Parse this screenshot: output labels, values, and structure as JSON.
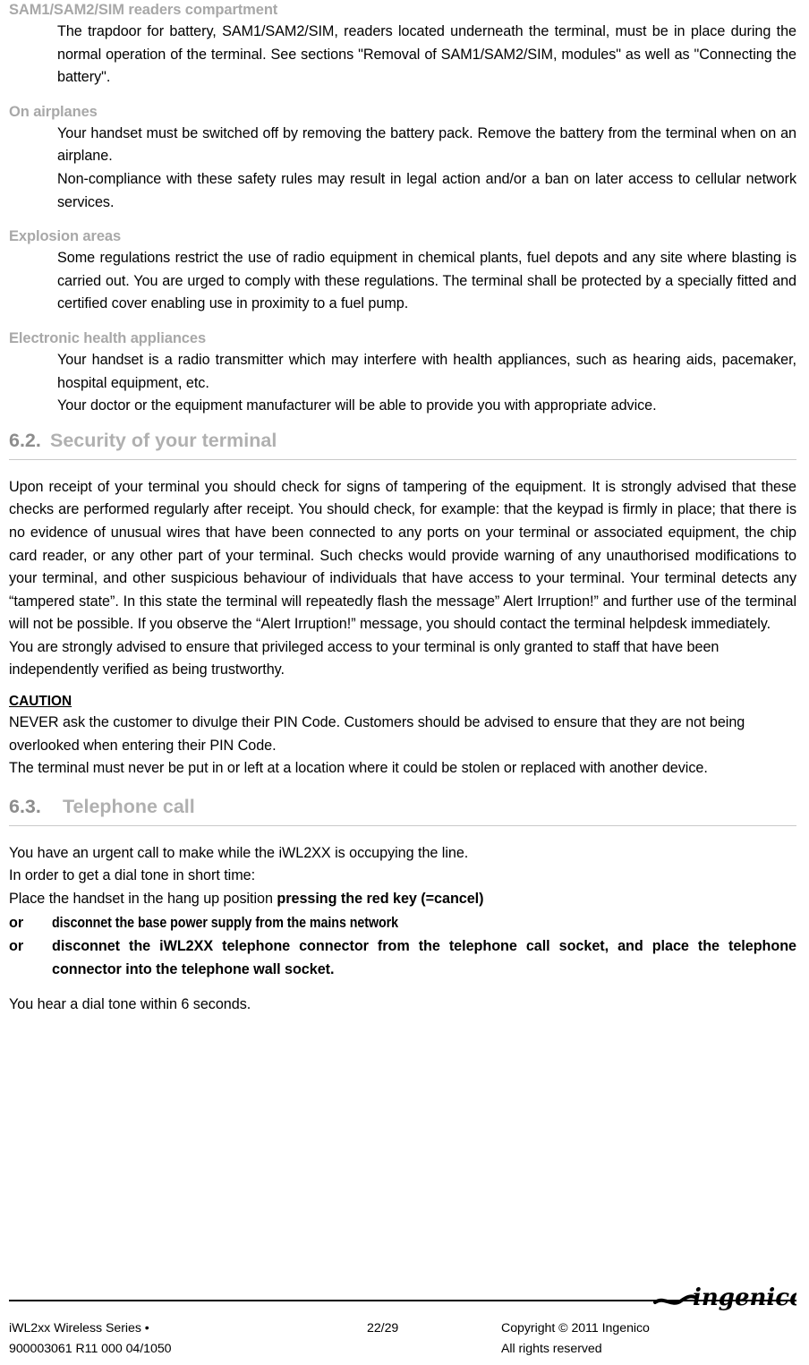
{
  "document": {
    "sections": [
      {
        "heading": "SAM1/SAM2/SIM readers compartment",
        "paragraphs": [
          "The trapdoor for battery, SAM1/SAM2/SIM, readers located underneath the terminal, must be in place during the normal operation of the terminal. See sections \"Removal of SAM1/SAM2/SIM, modules\" as well as \"Connecting the battery\"."
        ]
      },
      {
        "heading": "On airplanes",
        "paragraphs": [
          "Your handset must be switched off by removing the battery pack. Remove the battery from the terminal when on an airplane.",
          "Non-compliance with these safety rules may result in legal action and/or a ban on later access to cellular network services."
        ]
      },
      {
        "heading": "Explosion areas",
        "paragraphs": [
          "Some regulations restrict the use of radio equipment in chemical plants, fuel depots and any site where blasting is carried out. You are urged to comply with these regulations. The terminal shall be protected by a specially fitted and certified cover enabling use in proximity to a fuel pump."
        ]
      },
      {
        "heading": "Electronic health appliances",
        "paragraphs": [
          "Your handset is a radio transmitter which may interfere with health appliances, such as hearing aids, pacemaker, hospital equipment, etc.",
          "Your doctor or the equipment manufacturer will be able to provide you with appropriate advice."
        ]
      }
    ]
  },
  "section_62": {
    "number": "6.2.",
    "title": "Security of your terminal",
    "paragraphs": [
      "Upon receipt of your terminal you should check for signs of tampering of the equipment. It is strongly advised that these checks are performed regularly after receipt. You should check, for example: that the keypad is firmly in place; that there is no evidence of unusual wires that have been connected to any ports on your terminal or associated equipment, the chip card reader, or any other part of your terminal. Such checks would provide warning of any unauthorised modifications to your terminal, and other suspicious behaviour of individuals that have access to your terminal. Your terminal detects any “tampered state”. In this state the terminal will repeatedly flash the message” Alert Irruption!” and further use of the terminal will not be possible. If you observe the “Alert Irruption!” message, you should contact the terminal helpdesk immediately.",
      "You are strongly advised to ensure that privileged access to your terminal is only granted to staff that have been independently verified as being trustworthy."
    ],
    "caution_label": "CAUTION",
    "caution_paragraphs": [
      "NEVER ask the customer to divulge their PIN Code. Customers should be advised to ensure that they are not being overlooked when entering their PIN Code.",
      "The terminal must never be put in or left at a location where it could be stolen or replaced with another device."
    ]
  },
  "section_63": {
    "number": "6.3.",
    "title": "Telephone call",
    "intro_lines": [
      "You have an urgent call to make while the iWL2XX  is occupying the line.",
      "In order to get a dial tone in short time:"
    ],
    "place_line_normal": "Place the handset in the hang up position ",
    "place_line_bold": "pressing the red key (=cancel)",
    "or_label": "or",
    "or_option_1": "disconnet the base power supply from the mains network",
    "or_option_2": "disconnet the iWL2XX telephone connector from the telephone call socket, and place the telephone connector into the telephone wall socket.",
    "closing_line": "You hear a dial tone within 6 seconds."
  },
  "footer": {
    "product": "iWL2xx Wireless Series  •",
    "reference": "900003061 R11 000 04/1050",
    "page": "22/29",
    "copyright": "Copyright © 2011 Ingenico",
    "rights": "All rights reserved",
    "logo_text": "ingenico"
  },
  "colors": {
    "subheading": "#a8a8a8",
    "section_number": "#8d8d8d",
    "section_title": "#b0b0b0",
    "rule": "#c9c9c9",
    "text": "#000000"
  }
}
